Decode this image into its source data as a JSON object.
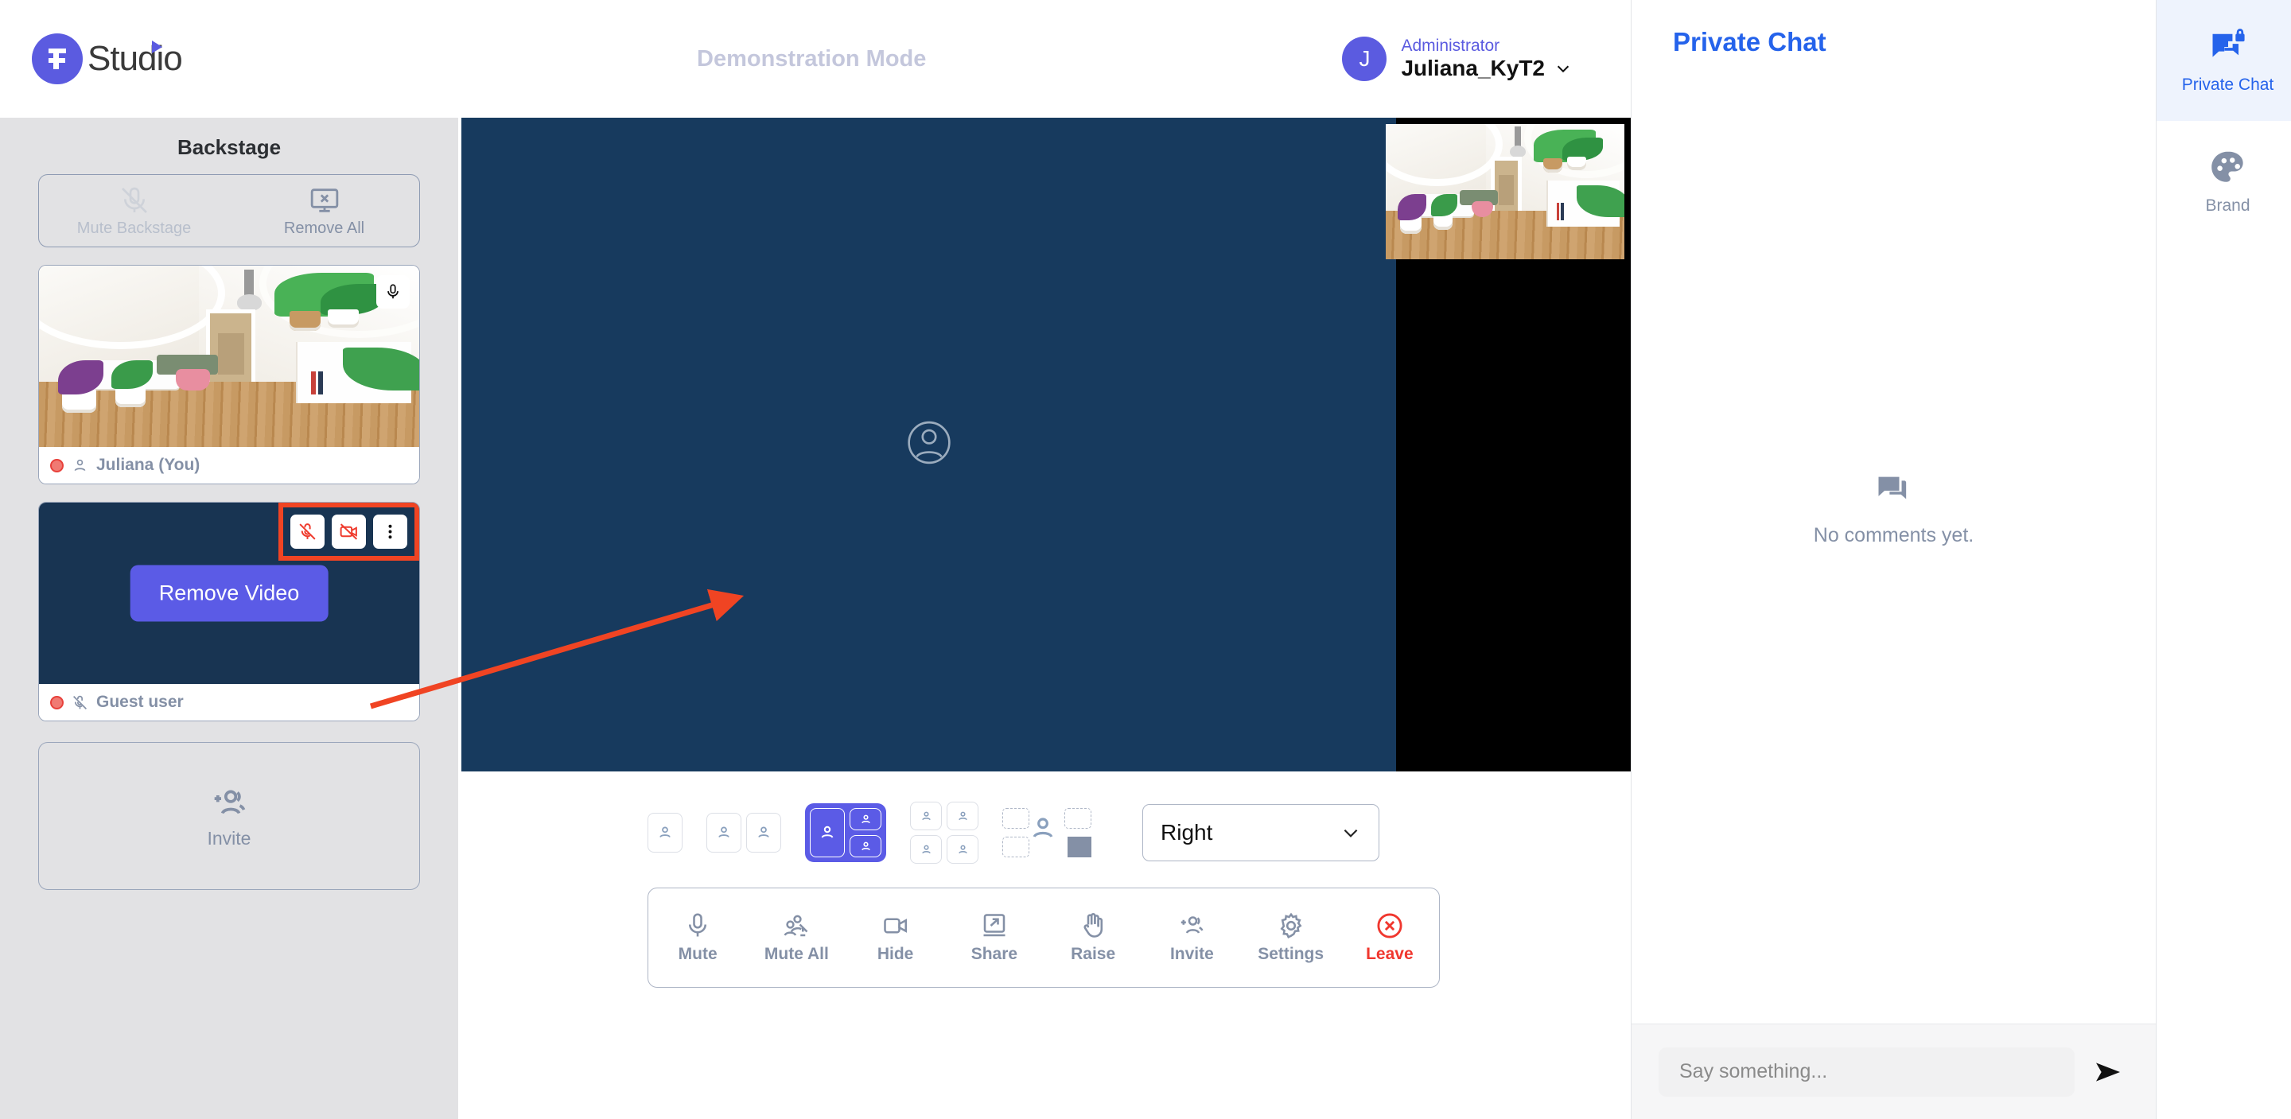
{
  "brand": {
    "name": "Studio",
    "logo_icon": "fh-studio-logo"
  },
  "topbar": {
    "mode_label": "Demonstration Mode",
    "user": {
      "initial": "J",
      "role": "Administrator",
      "name": "Juliana_KyT2",
      "chevron_icon": "chevron-down-icon"
    }
  },
  "backstage": {
    "title": "Backstage",
    "actions": [
      {
        "label": "Mute Backstage",
        "icon": "mute-backstage-icon",
        "disabled": true
      },
      {
        "label": "Remove All",
        "icon": "remove-all-screen-icon",
        "disabled": false
      }
    ],
    "participants": [
      {
        "name": "Juliana (You)",
        "recording_icon": "record-dot-icon",
        "status_icon": "person-icon",
        "mic_icon": "microphone-icon"
      },
      {
        "name": "Guest user",
        "recording_icon": "record-dot-icon",
        "status_icon": "microphone-off-icon"
      }
    ],
    "guest_controls": [
      {
        "icon": "microphone-off-icon",
        "name": "mute-guest-button"
      },
      {
        "icon": "camera-off-icon",
        "name": "remove-video-button"
      },
      {
        "icon": "more-vertical-icon",
        "name": "more-options-button"
      }
    ],
    "remove_video_button": "Remove Video",
    "invite": {
      "label": "Invite",
      "icon": "add-people-icon"
    }
  },
  "stage": {
    "placeholder_icon": "person-circle-icon",
    "pip_label": "self-view"
  },
  "layout_selector": {
    "options": [
      {
        "name": "layout-single",
        "type": "single",
        "active": false
      },
      {
        "name": "layout-two-up",
        "type": "two",
        "active": false
      },
      {
        "name": "layout-one-plus-two",
        "type": "one-plus-two",
        "active": true
      },
      {
        "name": "layout-grid-four",
        "type": "grid",
        "active": false
      },
      {
        "name": "layout-picture-in-picture",
        "type": "pip",
        "active": false
      }
    ],
    "position_select": {
      "value": "Right",
      "chevron_icon": "chevron-down-icon"
    }
  },
  "toolbar": [
    {
      "label": "Mute",
      "icon": "microphone-icon"
    },
    {
      "label": "Mute All",
      "icon": "mute-all-icon"
    },
    {
      "label": "Hide",
      "icon": "camera-icon"
    },
    {
      "label": "Share",
      "icon": "share-screen-icon"
    },
    {
      "label": "Raise",
      "icon": "raise-hand-icon"
    },
    {
      "label": "Invite",
      "icon": "add-people-icon"
    },
    {
      "label": "Settings",
      "icon": "gear-icon"
    },
    {
      "label": "Leave",
      "icon": "leave-x-circle-icon"
    }
  ],
  "chat": {
    "title": "Private Chat",
    "empty_icon": "comment-icon",
    "empty_text": "No comments yet.",
    "input_placeholder": "Say something...",
    "send_icon": "send-arrow-icon"
  },
  "rail": [
    {
      "label": "Private Chat",
      "icon": "private-chat-lock-icon",
      "active": true
    },
    {
      "label": "Brand",
      "icon": "palette-icon",
      "active": false
    }
  ],
  "colors": {
    "accent": "#5b5be6",
    "chat_blue": "#2563eb",
    "stage_navy": "#173a5e",
    "highlight_red": "#f04423",
    "leave_red": "#f0372e",
    "muted_text": "#8490a6"
  }
}
